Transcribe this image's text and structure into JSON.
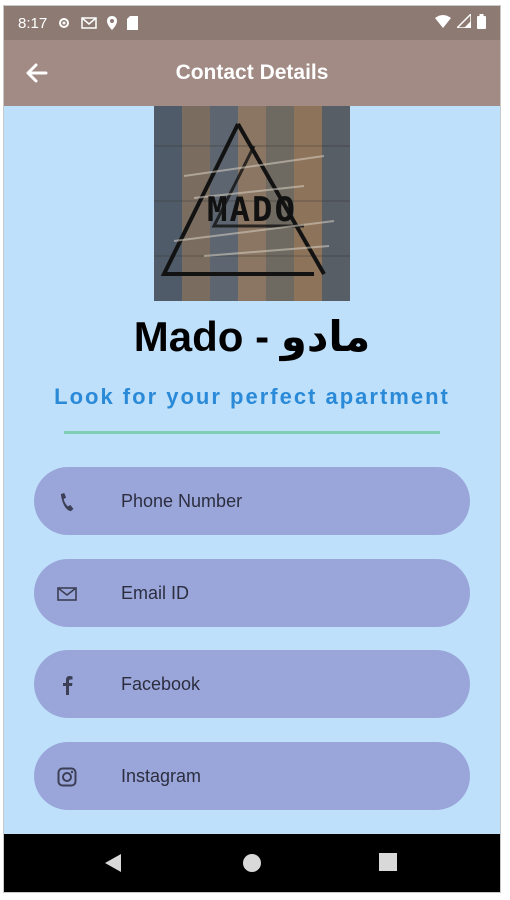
{
  "status_bar": {
    "time": "8:17"
  },
  "app_bar": {
    "title": "Contact Details"
  },
  "logo": {
    "text": "MADO"
  },
  "brand": {
    "name": "Mado - مادو"
  },
  "tagline": "Look for your perfect apartment",
  "fields": [
    {
      "label": "Phone Number",
      "icon": "phone-icon"
    },
    {
      "label": "Email ID",
      "icon": "email-icon"
    },
    {
      "label": "Facebook",
      "icon": "facebook-icon"
    },
    {
      "label": "Instagram",
      "icon": "instagram-icon"
    }
  ],
  "colors": {
    "background": "#bfe0fb",
    "app_bar": "#a18b84",
    "status_bar": "#8d7b73",
    "field": "#9aa6d9",
    "tagline": "#2a8ad8",
    "divider": "#7ecfb3"
  }
}
